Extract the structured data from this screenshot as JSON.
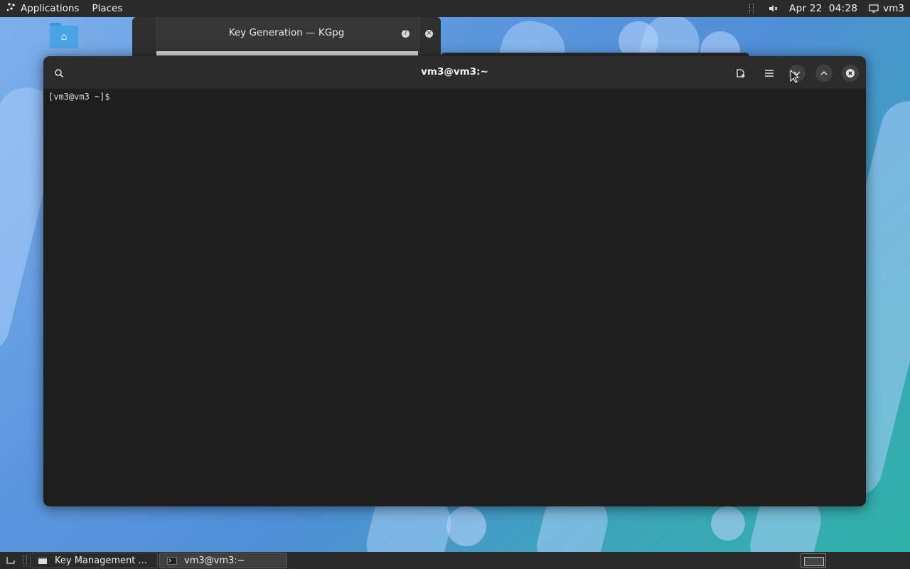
{
  "top_panel": {
    "applications_label": "Applications",
    "places_label": "Places",
    "clock": "Apr 22  04:28",
    "user_label": "vm3"
  },
  "kgpg_window": {
    "title": "Key Generation — KGpg"
  },
  "terminal": {
    "title": "vm3@vm3:~",
    "prompt": "[vm3@vm3 ~]$"
  },
  "taskbar": {
    "tasks": [
      {
        "label": "Key Management ..."
      },
      {
        "label": "vm3@vm3:~"
      }
    ]
  }
}
